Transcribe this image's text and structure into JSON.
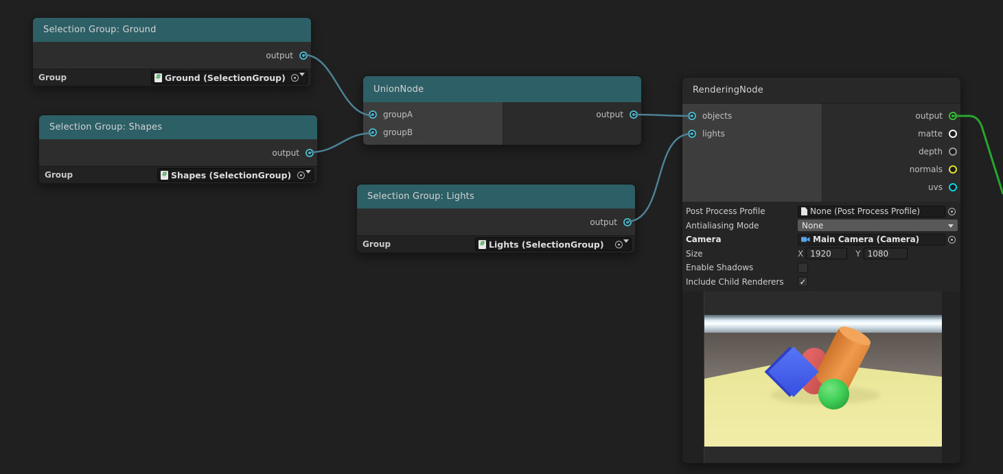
{
  "colors": {
    "canvas_bg": "#202020",
    "node_header_teal": "#2d5f66",
    "wire_teal": "#4d8397",
    "wire_green": "#28a72e",
    "port_teal": "#49b6c9",
    "port_output_green": "#3cc23c",
    "port_matte": "#ffffff",
    "port_depth": "#9a9a9a",
    "port_normals": "#e3e32a",
    "port_uvs": "#00dcec"
  },
  "icons": {
    "selection_group_asset": "selection-group-asset-icon",
    "object_picker": "object-picker-icon",
    "dropdown_caret": "chevron-down-icon",
    "post_process_asset": "file-icon",
    "camera_asset": "camera-icon",
    "checkmark": "check-icon"
  },
  "nodes": {
    "ground": {
      "title": "Selection Group: Ground",
      "output_label": "output",
      "group_label": "Group",
      "group_value": "Ground (SelectionGroup)"
    },
    "shapes": {
      "title": "Selection Group: Shapes",
      "output_label": "output",
      "group_label": "Group",
      "group_value": "Shapes (SelectionGroup)"
    },
    "lights": {
      "title": "Selection Group: Lights",
      "output_label": "output",
      "group_label": "Group",
      "group_value": "Lights (SelectionGroup)"
    },
    "union": {
      "title": "UnionNode",
      "input_a": "groupA",
      "input_b": "groupB",
      "output_label": "output"
    },
    "rendering": {
      "title": "RenderingNode",
      "input_objects": "objects",
      "input_lights": "lights",
      "outputs": [
        {
          "label": "output",
          "color": "#3cc23c",
          "connected": true
        },
        {
          "label": "matte",
          "color": "#ffffff",
          "connected": false
        },
        {
          "label": "depth",
          "color": "#9a9a9a",
          "connected": false
        },
        {
          "label": "normals",
          "color": "#e3e32a",
          "connected": false
        },
        {
          "label": "uvs",
          "color": "#00dcec",
          "connected": false
        }
      ],
      "properties": {
        "post_process_profile": {
          "label": "Post Process Profile",
          "value": "None (Post Process Profile)"
        },
        "antialiasing_mode": {
          "label": "Antialiasing Mode",
          "value": "None"
        },
        "camera": {
          "label": "Camera",
          "value": "Main Camera (Camera)"
        },
        "size": {
          "label": "Size",
          "x_label": "X",
          "x_value": "1920",
          "y_label": "Y",
          "y_value": "1080"
        },
        "enable_shadows": {
          "label": "Enable Shadows",
          "checked": false
        },
        "include_child_renderers": {
          "label": "Include Child Renderers",
          "checked": true,
          "check_glyph": "✓"
        }
      }
    }
  }
}
